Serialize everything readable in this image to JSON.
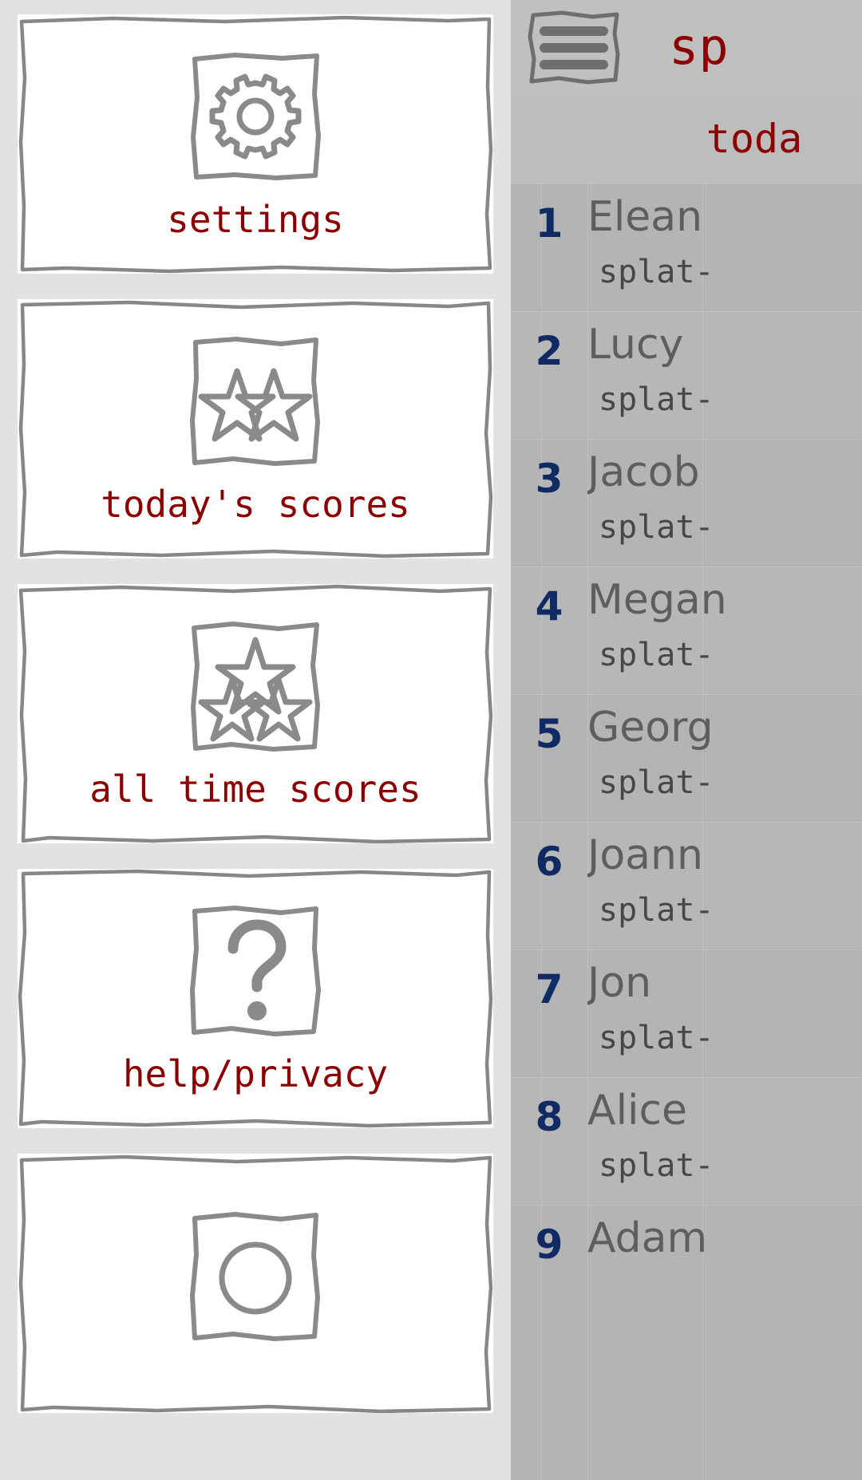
{
  "colors": {
    "accent_red": "#8b0000",
    "rank_blue": "#102a63",
    "sidebar_bg": "#e2e2e2",
    "card_bg": "#ffffff",
    "panel_bg": "#b4b4b4",
    "topbar_bg": "#c0c0c0",
    "sketch_stroke": "#8a8a8a",
    "name_gray": "#5e5e5e"
  },
  "sidebar": {
    "items": [
      {
        "label": "settings",
        "icon": "gear-icon"
      },
      {
        "label": "today's scores",
        "icon": "two-stars-icon"
      },
      {
        "label": "all time scores",
        "icon": "three-stars-icon"
      },
      {
        "label": "help/privacy",
        "icon": "question-mark-icon"
      },
      {
        "label": "",
        "icon": "circle-icon"
      }
    ]
  },
  "topbar": {
    "menu_icon": "hamburger-icon",
    "app_title": "sp"
  },
  "scores_header": {
    "title": "toda"
  },
  "scores_table": {
    "rows": [
      {
        "rank": "1",
        "name": "Elean",
        "detail": "splat-"
      },
      {
        "rank": "2",
        "name": "Lucy",
        "detail": "splat-"
      },
      {
        "rank": "3",
        "name": "Jacob",
        "detail": "splat-"
      },
      {
        "rank": "4",
        "name": "Megan",
        "detail": "splat-"
      },
      {
        "rank": "5",
        "name": "Georg",
        "detail": "splat-"
      },
      {
        "rank": "6",
        "name": "Joann",
        "detail": "splat-"
      },
      {
        "rank": "7",
        "name": "Jon",
        "detail": "splat-"
      },
      {
        "rank": "8",
        "name": "Alice",
        "detail": "splat-"
      },
      {
        "rank": "9",
        "name": "Adam",
        "detail": ""
      }
    ]
  }
}
